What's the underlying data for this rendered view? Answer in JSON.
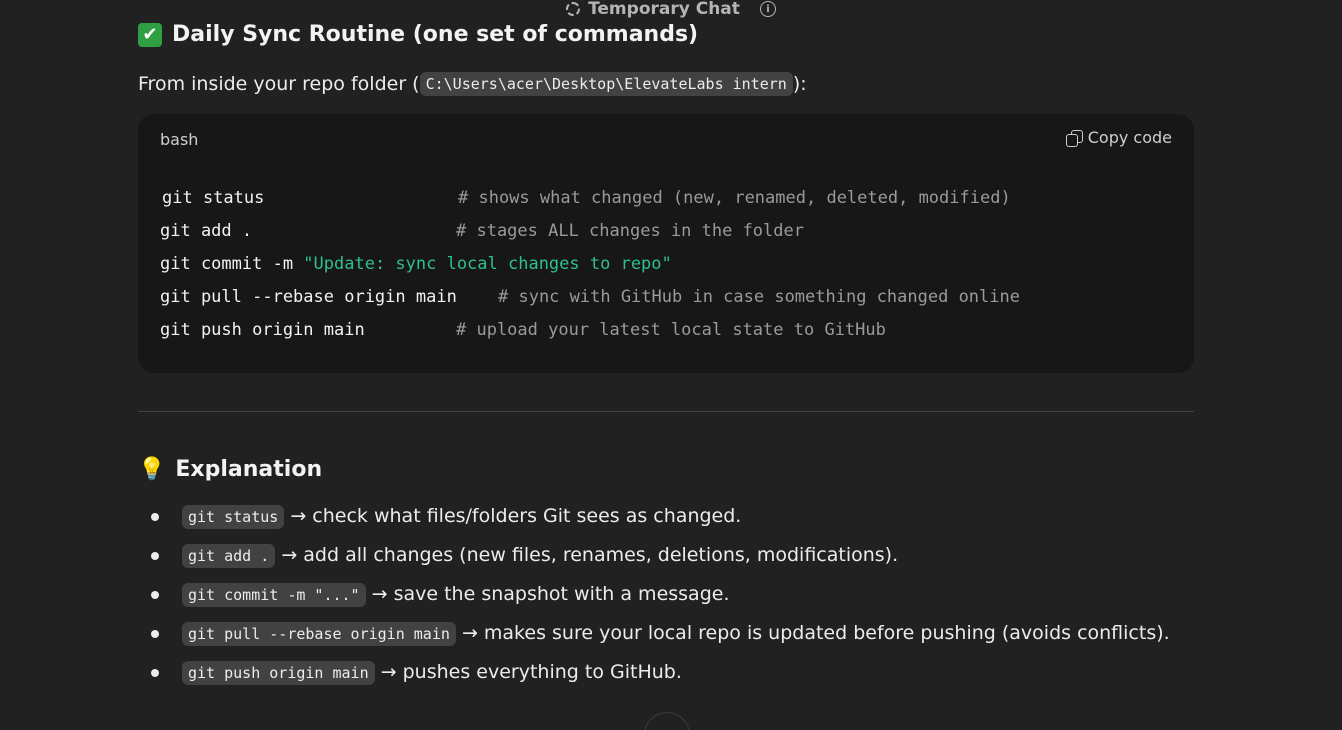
{
  "header": {
    "title": "Temporary Chat",
    "temp_icon": "dashed-circle-icon",
    "info_icon": "info-icon"
  },
  "section1": {
    "emoji": "✔",
    "title": "Daily Sync Routine (one set of commands)",
    "intro_before": "From inside your repo folder (",
    "intro_path": "C:\\Users\\acer\\Desktop\\ElevateLabs intern",
    "intro_after": "):"
  },
  "code_block": {
    "language": "bash",
    "copy_label": "Copy code",
    "lines": [
      {
        "cmd": "git status",
        "string": "",
        "comment": "# shows what changed (new, renamed, deleted, modified)"
      },
      {
        "cmd": "git add .",
        "string": "",
        "comment": "# stages ALL changes in the folder"
      },
      {
        "cmd": "git commit -m ",
        "string": "\"Update: sync local changes to repo\"",
        "comment": ""
      },
      {
        "cmd": "git pull --rebase origin main",
        "string": "",
        "comment": "# sync with GitHub in case something changed online"
      },
      {
        "cmd": "git push origin main",
        "string": "",
        "comment": "# upload your latest local state to GitHub"
      }
    ]
  },
  "section2": {
    "emoji": "💡",
    "title": "Explanation",
    "items": [
      {
        "code": "git status",
        "text": " → check what files/folders Git sees as changed."
      },
      {
        "code": "git add .",
        "text": " → add all changes (new files, renames, deletions, modifications)."
      },
      {
        "code": "git commit -m \"...\"",
        "text": " → save the snapshot with a message."
      },
      {
        "code": "git pull --rebase origin main",
        "text": " → makes sure your local repo is updated before pushing (avoids conflicts)."
      },
      {
        "code": "git push origin main",
        "text": " → pushes everything to GitHub."
      }
    ]
  },
  "colors": {
    "background": "#212121",
    "code_background": "#171717",
    "string_color": "#2fbf8f",
    "comment_color": "#9a9a9a",
    "check_green": "#2ea043"
  }
}
